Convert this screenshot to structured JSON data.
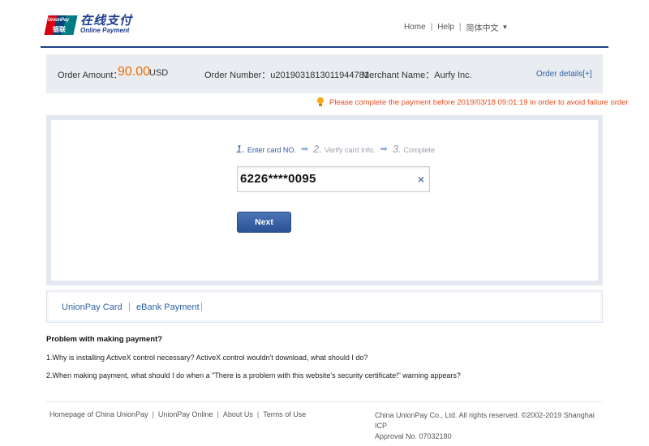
{
  "brand": {
    "mark_line1": "UnionPay",
    "mark_line2": "银联",
    "name_cn": "在线支付",
    "name_en": "Online Payment"
  },
  "topnav": {
    "home": "Home",
    "help": "Help",
    "language": "简体中文",
    "sep": "|"
  },
  "order": {
    "amount_label": "Order Amount：",
    "amount_value": "90.00",
    "currency": "USD",
    "number_label": "Order Number：",
    "number_value": "u2019031813011944781",
    "merchant_label": "Merchant Name：",
    "merchant_value": "Aurfy Inc.",
    "details_link": "Order details[+]"
  },
  "warning": "Please complete the payment before 2019/03/18 09:01:19 in order to avoid failure order",
  "steps": [
    {
      "num": "1.",
      "label": "Enter card NO."
    },
    {
      "num": "2.",
      "label": "Verify card Info."
    },
    {
      "num": "3.",
      "label": "Complete"
    }
  ],
  "card_input": {
    "value": "6226****0095",
    "clear": "×"
  },
  "next_button": "Next",
  "payment_options": [
    "UnionPay Card",
    "eBank Payment"
  ],
  "faq": {
    "title": "Problem with making payment?",
    "items": [
      "1.Why is installing ActiveX control necessary? ActiveX control wouldn't download, what should I do?",
      "2.When making payment, what should I do when a \"There is a problem with this website's security certificate!\" warning appears?"
    ]
  },
  "footer": {
    "links": [
      "Homepage of China UnionPay",
      "UnionPay Online",
      "About Us",
      "Terms of Use"
    ],
    "copyright_line1": "China UnionPay Co., Ltd. All rights reserved. ©2002-2019 Shanghai ICP",
    "copyright_line2": "Approval No. 07032180"
  },
  "colors": {
    "accent": "#1e4189",
    "amount": "#f06c00",
    "warning": "#e84b1f",
    "link": "#2f61a6"
  }
}
